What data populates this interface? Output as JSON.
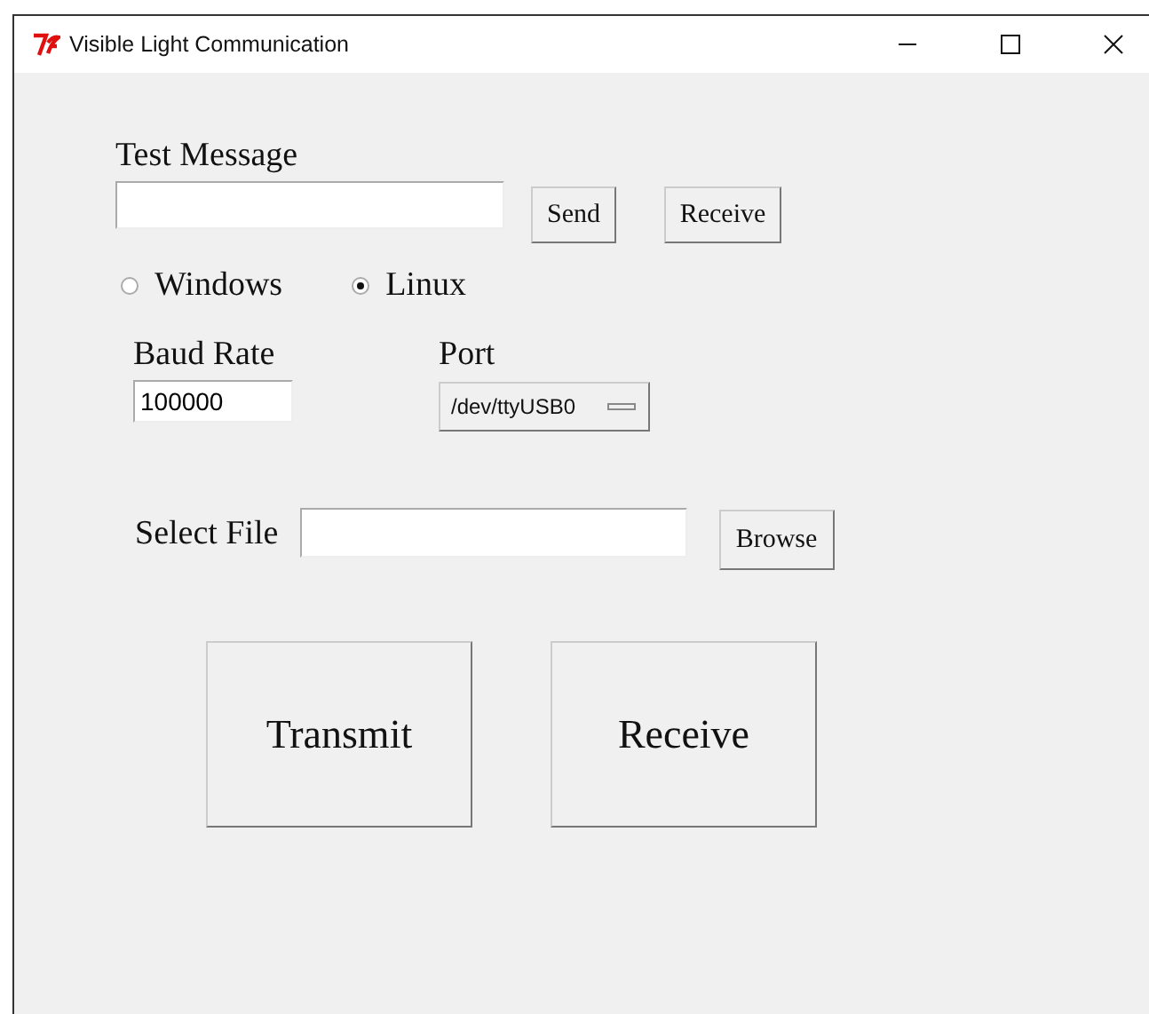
{
  "window": {
    "title": "Visible Light Communication"
  },
  "test_message": {
    "label": "Test Message",
    "buttons": [
      "Send",
      "Receive"
    ]
  },
  "os_options": [
    {
      "label": "Windows",
      "selected": false
    },
    {
      "label": "Linux",
      "selected": true
    }
  ],
  "baud_rate": {
    "label": "Baud Rate",
    "value": "100000"
  },
  "port": {
    "label": "Port",
    "value": "/dev/ttyUSB0"
  },
  "select_file": {
    "label": "Select File",
    "button": "Browse"
  },
  "actions": [
    "Transmit",
    "Receive"
  ]
}
